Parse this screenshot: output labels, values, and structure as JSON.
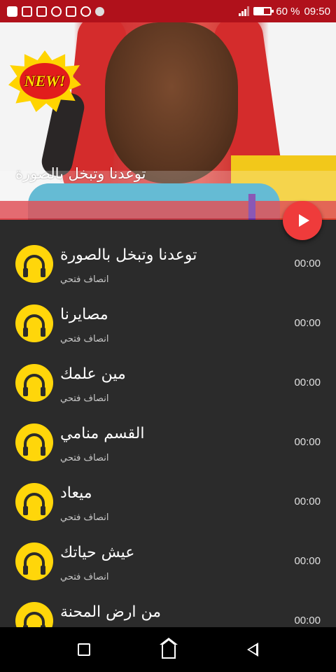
{
  "status_bar": {
    "battery_text": "60 %",
    "time": "09:50",
    "battery_level": 0.6,
    "icons": [
      "facebook-icon",
      "app-icon",
      "gift-icon",
      "messenger-icon",
      "sim-icon",
      "whatsapp-icon",
      "dot-icon"
    ],
    "background": "#b0111b"
  },
  "header": {
    "badge_text": "NEW!",
    "now_playing_title": "توعدنا وتبخل بالصورة"
  },
  "play_button": {
    "icon": "play-icon",
    "color": "#ef3b3b"
  },
  "songs": [
    {
      "title": "توعدنا وتبخل بالصورة",
      "artist": "انصاف فتحي",
      "duration": "00:00"
    },
    {
      "title": "مصايرنا",
      "artist": "انصاف فتحي",
      "duration": "00:00"
    },
    {
      "title": "مين علمك",
      "artist": "انصاف فتحي",
      "duration": "00:00"
    },
    {
      "title": "القسم منامي",
      "artist": "انصاف فتحي",
      "duration": "00:00"
    },
    {
      "title": "ميعاد",
      "artist": "انصاف فتحي",
      "duration": "00:00"
    },
    {
      "title": "عيش حياتك",
      "artist": "انصاف فتحي",
      "duration": "00:00"
    },
    {
      "title": "من ارض المحنة",
      "artist": "",
      "duration": "00:00"
    }
  ],
  "list_icon": "headphones-icon",
  "accent_yellow": "#ffd60a",
  "nav": {
    "icons": [
      "recents-icon",
      "home-icon",
      "back-icon"
    ]
  }
}
